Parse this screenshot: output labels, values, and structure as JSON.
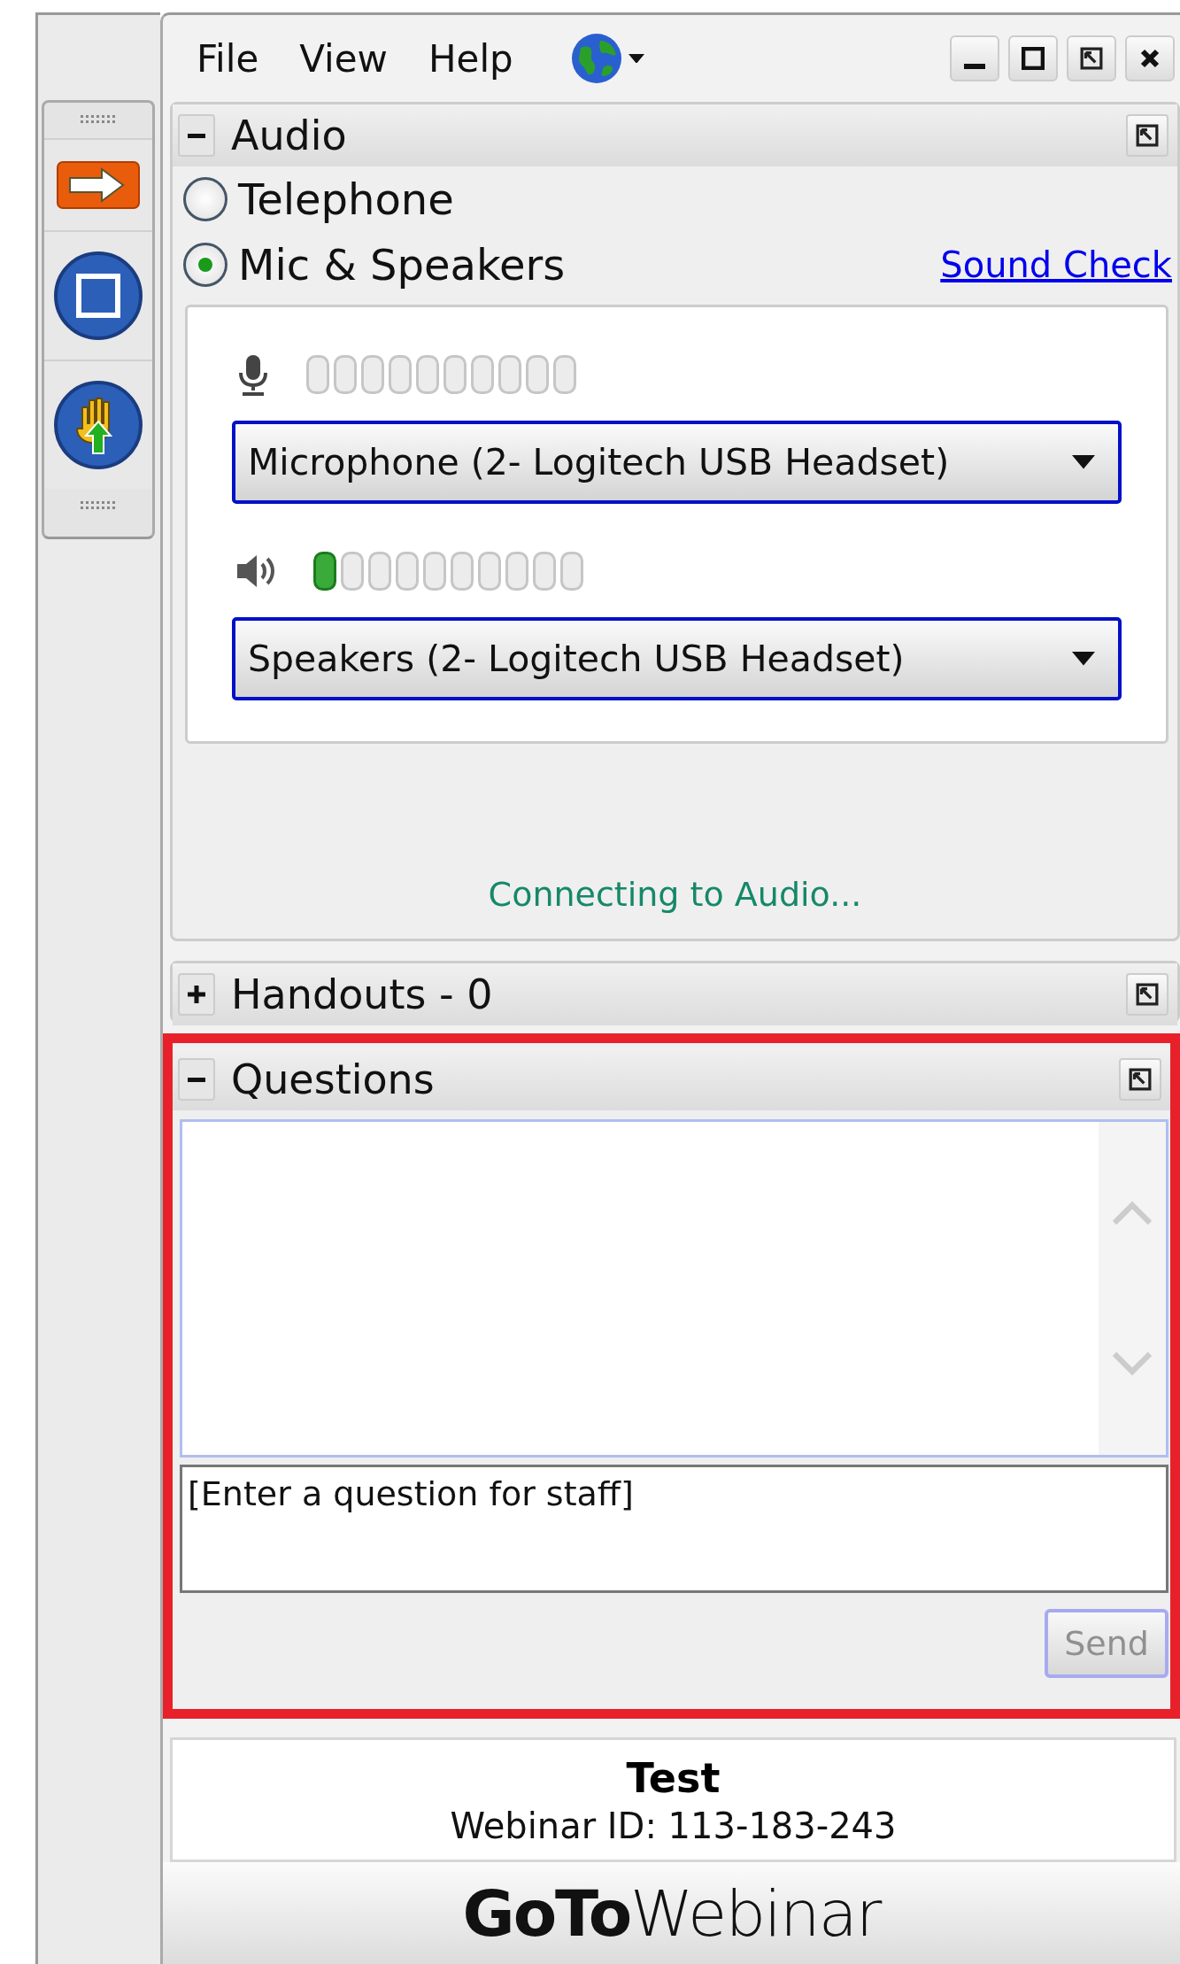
{
  "menu": [
    {
      "label": "File"
    },
    {
      "label": "View"
    },
    {
      "label": "Help"
    }
  ],
  "audio": {
    "title": "Audio",
    "expanded": true,
    "options": [
      {
        "label": "Telephone",
        "selected": false
      },
      {
        "label": "Mic & Speakers",
        "selected": true
      }
    ],
    "sound_check": "Sound Check",
    "microphone": {
      "device": "Microphone (2- Logitech USB Headset)"
    },
    "speakers": {
      "device": "Speakers (2- Logitech USB Headset)"
    },
    "status": "Connecting to Audio..."
  },
  "handouts": {
    "title": "Handouts - 0",
    "expanded": false
  },
  "questions": {
    "title": "Questions",
    "expanded": true,
    "highlighted": true,
    "placeholder": "[Enter a question for staff]",
    "send": "Send",
    "send_disabled": true
  },
  "info": {
    "title": "Test",
    "webinar_id": "Webinar ID: 113-183-243"
  },
  "logo": {
    "bold": "GoTo",
    "light": "Webinar"
  }
}
